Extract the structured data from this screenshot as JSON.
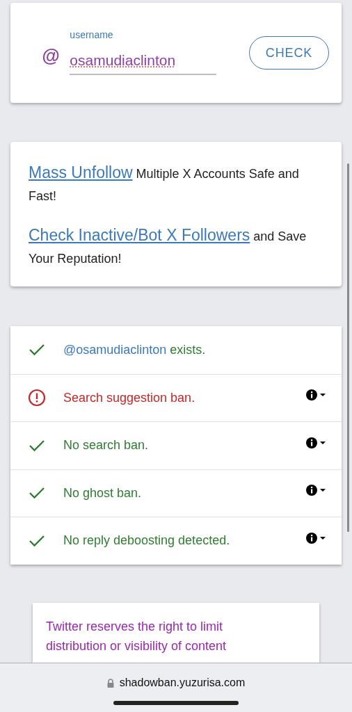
{
  "search": {
    "label": "username",
    "prefix": "@",
    "value": "osamudiaclinton",
    "button": "CHECK"
  },
  "promo": [
    {
      "link": "Mass Unfollow",
      "text": "Multiple X Accounts Safe and Fast!"
    },
    {
      "link": "Check Inactive/Bot X Followers",
      "text": "and Save Your Reputation!"
    }
  ],
  "results": [
    {
      "kind": "ok",
      "handle": "@osamudiaclinton",
      "text": "exists.",
      "details": false
    },
    {
      "kind": "error",
      "text": "Search suggestion ban.",
      "details": true
    },
    {
      "kind": "ok",
      "text": "No search ban.",
      "details": true
    },
    {
      "kind": "ok",
      "text": "No ghost ban.",
      "details": true
    },
    {
      "kind": "ok",
      "text": "No reply deboosting detected.",
      "details": true
    }
  ],
  "notice": {
    "lines": [
      "Twitter reserves the right to limit",
      "distribution or visibility of content"
    ]
  },
  "browser": {
    "url": "shadowban.yuzurisa.com"
  }
}
